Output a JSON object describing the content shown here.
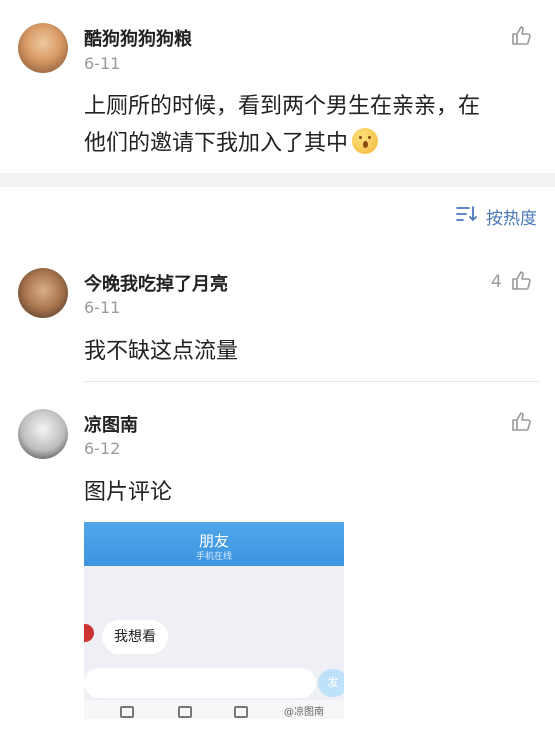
{
  "post": {
    "username": "酷狗狗狗狗粮",
    "date": "6-11",
    "content_line1": "上厕所的时候，看到两个男生在亲亲，在",
    "content_line2": "他们的邀请下我加入了其中",
    "emoji": "😮"
  },
  "sort": {
    "label": "按热度",
    "icon": "sort-icon"
  },
  "comments": [
    {
      "username": "今晚我吃掉了月亮",
      "date": "6-11",
      "like_count": "4",
      "content": "我不缺这点流量"
    },
    {
      "username": "凉图南",
      "date": "6-12",
      "content": "图片评论",
      "image": {
        "header_title": "朋友",
        "header_subtitle": "手机在线",
        "bubble": "我想看",
        "send": "发",
        "watermark": "@凉图南"
      }
    }
  ],
  "colors": {
    "accent": "#4a78b8",
    "band": "#f2f2f2"
  }
}
